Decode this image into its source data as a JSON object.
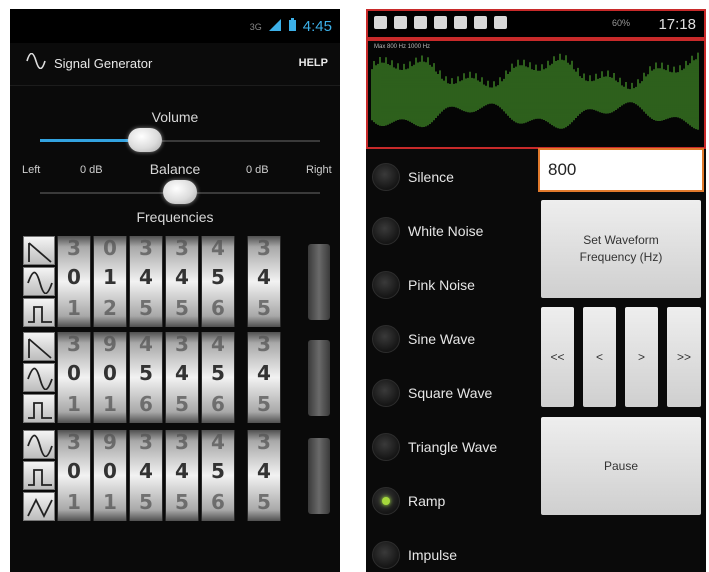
{
  "left_app": {
    "status": {
      "clock": "4:45",
      "net_label": "3G"
    },
    "title": "Signal Generator",
    "help_label": "HELP",
    "volume_label": "Volume",
    "volume_level": 0.36,
    "balance": {
      "label": "Balance",
      "left_label": "Left",
      "left_db": "0 dB",
      "right_db": "0 dB",
      "right_label": "Right",
      "level": 0.5
    },
    "frequencies_label": "Frequencies",
    "banks": [
      {
        "waves": [
          "ramp-down",
          "sine",
          "square"
        ],
        "wheels": [
          [
            "3",
            "0",
            "1"
          ],
          [
            "0",
            "1",
            "2"
          ],
          [
            "3",
            "4",
            "5"
          ],
          [
            "3",
            "4",
            "5"
          ],
          [
            "4",
            "5",
            "6"
          ],
          [
            "3",
            "4",
            "5"
          ]
        ]
      },
      {
        "waves": [
          "ramp-down",
          "sine",
          "square"
        ],
        "wheels": [
          [
            "3",
            "0",
            "1"
          ],
          [
            "9",
            "0",
            "1"
          ],
          [
            "4",
            "5",
            "6"
          ],
          [
            "3",
            "4",
            "5"
          ],
          [
            "4",
            "5",
            "6"
          ],
          [
            "3",
            "4",
            "5"
          ]
        ]
      },
      {
        "waves": [
          "sine",
          "square",
          "triangle"
        ],
        "wheels": [
          [
            "3",
            "0",
            "1"
          ],
          [
            "9",
            "0",
            "1"
          ],
          [
            "3",
            "4",
            "5"
          ],
          [
            "3",
            "4",
            "5"
          ],
          [
            "4",
            "5",
            "6"
          ],
          [
            "3",
            "4",
            "5"
          ]
        ]
      }
    ]
  },
  "right_app": {
    "status": {
      "clock": "17:18",
      "battery": "60%"
    },
    "scope_label": "Max 800 Hz 1000 Hz",
    "modes": [
      {
        "label": "Silence",
        "selected": false
      },
      {
        "label": "White Noise",
        "selected": false
      },
      {
        "label": "Pink Noise",
        "selected": false
      },
      {
        "label": "Sine Wave",
        "selected": false
      },
      {
        "label": "Square Wave",
        "selected": false
      },
      {
        "label": "Triangle Wave",
        "selected": false
      },
      {
        "label": "Ramp",
        "selected": true
      },
      {
        "label": "Impulse",
        "selected": false
      }
    ],
    "frequency_value": "800",
    "set_freq_label": "Set Waveform Frequency (Hz)",
    "step_buttons": [
      "<<",
      "<",
      ">",
      ">>"
    ],
    "pause_label": "Pause"
  },
  "colors": {
    "accent_blue": "#33a3e0",
    "input_border": "#e27a2c",
    "scope_green": "#5fcf3a",
    "highlight_red": "#c82a2a"
  }
}
